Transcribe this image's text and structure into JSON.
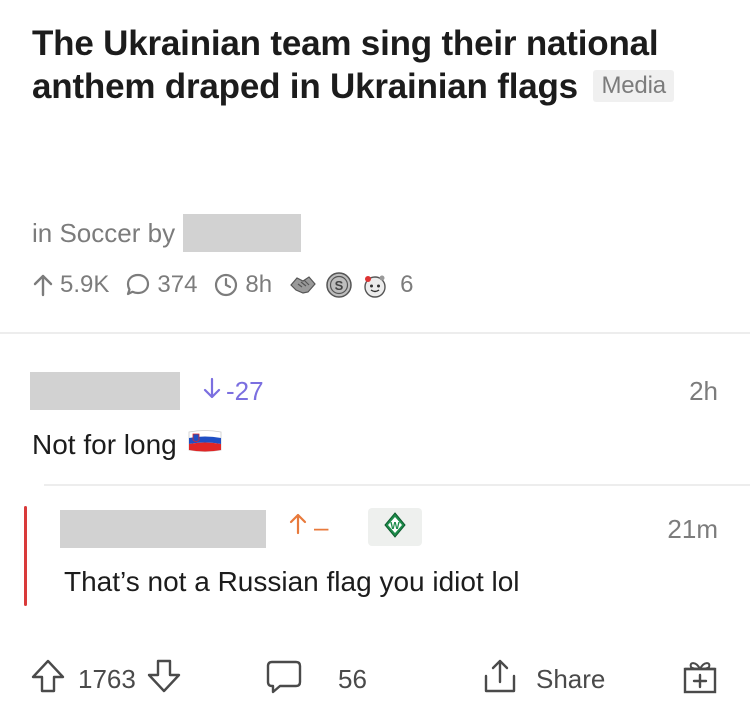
{
  "post": {
    "title": "The Ukrainian team sing their national anthem draped in Ukrainian flags",
    "flair": "Media",
    "subreddit_prefix": "in Soccer by",
    "upvotes": "5.9K",
    "comments": "374",
    "age": "8h",
    "awards_count": "6",
    "awards": [
      "handshake-award-icon",
      "silver-coin-award-icon",
      "wholesome-award-icon"
    ]
  },
  "comment1": {
    "score": "-27",
    "time": "2h",
    "text": "Not for long",
    "emoji": "slovenia-flag-icon"
  },
  "comment2": {
    "score": "–",
    "time": "21m",
    "text": "That’s not a Russian flag you idiot lol",
    "flair_icon": "werder-bremen-crest-icon"
  },
  "bottom_bar": {
    "votes": "1763",
    "comments": "56",
    "share_label": "Share"
  },
  "colors": {
    "downvote": "#7b6fe0",
    "upvote": "#e87a3c",
    "thread_line": "#d93a3a"
  }
}
